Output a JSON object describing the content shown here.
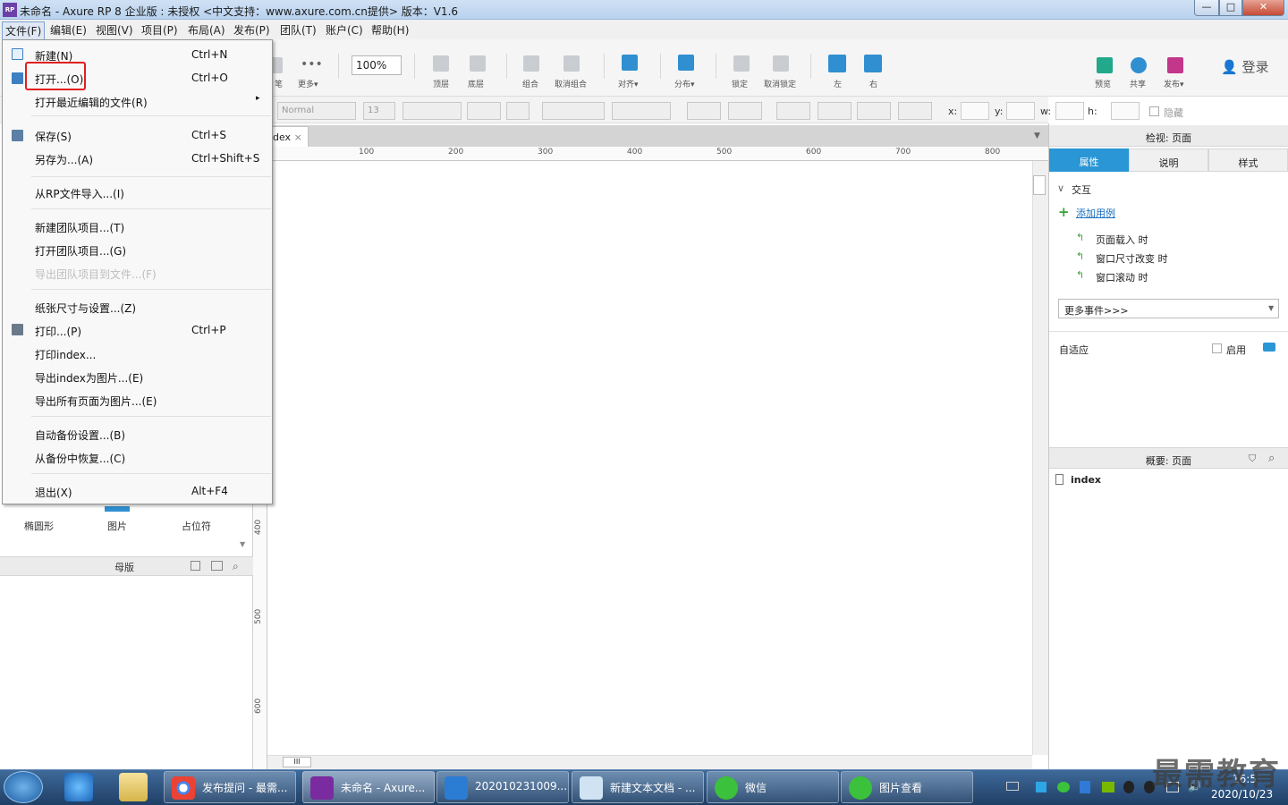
{
  "window": {
    "app_icon_text": "RP",
    "title": "未命名 - Axure RP 8 企业版 : 未授权    <中文支持：www.axure.com.cn提供> 版本：V1.6",
    "min": "—",
    "max": "□",
    "close": "✕"
  },
  "menubar": [
    "文件(F)",
    "编辑(E)",
    "视图(V)",
    "项目(P)",
    "布局(A)",
    "发布(P)",
    "团队(T)",
    "账户(C)",
    "帮助(H)"
  ],
  "toolbar": {
    "zoom_value": "100%",
    "zoom_label": "缩放",
    "labels": {
      "pen": "笔",
      "more": "更多▾",
      "top": "顶层",
      "bottom": "底层",
      "group": "组合",
      "ungroup": "取消组合",
      "align": "对齐▾",
      "distribute": "分布▾",
      "lock": "锁定",
      "unlock": "取消锁定",
      "left": "左",
      "right": "右",
      "preview": "预览",
      "share": "共享",
      "publish": "发布▾"
    },
    "login": "登录"
  },
  "formatbar": {
    "style": "Normal",
    "font_size": "13",
    "x_label": "x:",
    "y_label": "y:",
    "w_label": "w:",
    "h_label": "h:",
    "hide_label": "隐藏"
  },
  "file_menu": {
    "items": [
      {
        "label": "新建(N)",
        "shortcut": "Ctrl+N",
        "icon": "new-file-icon"
      },
      {
        "label": "打开...(O)",
        "shortcut": "Ctrl+O",
        "icon": "open-folder-icon"
      },
      {
        "label": "打开最近编辑的文件(R)",
        "shortcut": "",
        "submenu": "▸"
      },
      {
        "label": "保存(S)",
        "shortcut": "Ctrl+S",
        "icon": "save-icon"
      },
      {
        "label": "另存为...(A)",
        "shortcut": "Ctrl+Shift+S"
      },
      {
        "label": "从RP文件导入...(I)",
        "shortcut": ""
      },
      {
        "label": "新建团队项目...(T)",
        "shortcut": ""
      },
      {
        "label": "打开团队项目...(G)",
        "shortcut": ""
      },
      {
        "label": "导出团队项目到文件...(F)",
        "shortcut": "",
        "disabled": true
      },
      {
        "label": "纸张尺寸与设置...(Z)",
        "shortcut": ""
      },
      {
        "label": "打印...(P)",
        "shortcut": "Ctrl+P",
        "icon": "print-icon"
      },
      {
        "label": "打印index...",
        "shortcut": ""
      },
      {
        "label": "导出index为图片...(E)",
        "shortcut": ""
      },
      {
        "label": "导出所有页面为图片...(E)",
        "shortcut": ""
      },
      {
        "label": "自动备份设置...(B)",
        "shortcut": ""
      },
      {
        "label": "从备份中恢复...(C)",
        "shortcut": ""
      },
      {
        "label": "退出(X)",
        "shortcut": "Alt+F4"
      }
    ]
  },
  "left_panel": {
    "widgets": [
      "椭圆形",
      "图片",
      "占位符"
    ],
    "masters_title": "母版"
  },
  "canvas": {
    "tab_label": "dex",
    "tab_close": "×",
    "ruler_h": [
      "100",
      "200",
      "300",
      "400",
      "500",
      "600",
      "700",
      "800"
    ],
    "ruler_v": [
      "400",
      "500",
      "600"
    ],
    "hscroll_thumb": "III"
  },
  "right_panel": {
    "inspect_title": "检视: 页面",
    "tabs": [
      "属性",
      "说明",
      "样式"
    ],
    "interaction_title": "交互",
    "add_case": "添加用例",
    "events": [
      "页面载入 时",
      "窗口尺寸改变 时",
      "窗口滚动 时"
    ],
    "more_events": "更多事件>>>",
    "adaptive_label": "自适应",
    "enable_label": "启用",
    "outline_title": "概要: 页面",
    "outline_page": "index"
  },
  "taskbar": {
    "tasks": [
      "发布提问 - 最需...",
      "未命名 - Axure...",
      "20201023​1009...",
      "新建文本文档 - ...",
      "微信",
      "图片查看"
    ],
    "time": "16:5",
    "date": "2020/10/23",
    "watermark": "最需教育"
  },
  "colors": {
    "accent": "#2a96d5",
    "highlight": "#e02020",
    "taskbar": "#1f3f66"
  }
}
